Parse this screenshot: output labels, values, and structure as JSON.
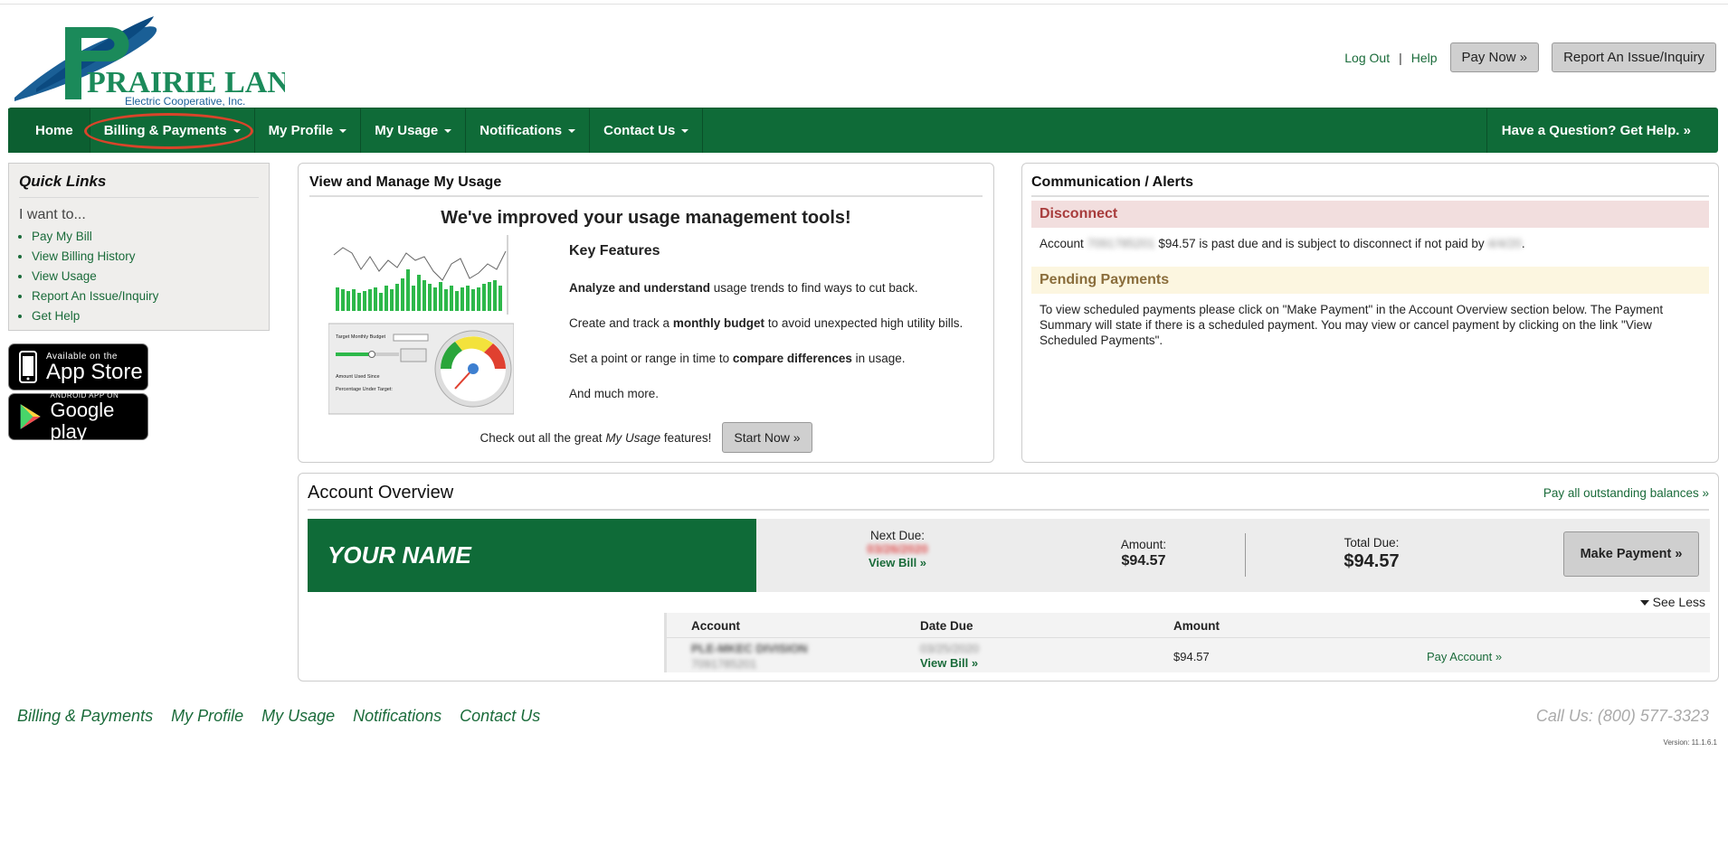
{
  "header": {
    "logo_text": "PRAIRIE LAND",
    "logo_sub": "Electric Cooperative, Inc.",
    "logout": "Log Out",
    "separator": "|",
    "help": "Help",
    "pay_now": "Pay Now »",
    "report_issue": "Report An Issue/Inquiry"
  },
  "nav": {
    "items": [
      {
        "label": "Home"
      },
      {
        "label": "Billing & Payments"
      },
      {
        "label": "My Profile"
      },
      {
        "label": "My Usage"
      },
      {
        "label": "Notifications"
      },
      {
        "label": "Contact Us"
      }
    ],
    "help_right": "Have a Question? Get Help. »"
  },
  "quick_links": {
    "title": "Quick Links",
    "intro": "I want to...",
    "items": [
      "Pay My Bill",
      "View Billing History",
      "View Usage",
      "Report An Issue/Inquiry",
      "Get Help"
    ]
  },
  "badges": {
    "apple_small": "Available on the",
    "apple_big": "App Store",
    "google_small": "ANDROID APP ON",
    "google_big": "Google play"
  },
  "usage": {
    "title": "View and Manage My Usage",
    "headline": "We've improved your usage management tools!",
    "features_title": "Key Features",
    "f1_bold": "Analyze and understand",
    "f1_rest": " usage trends to find ways to cut back.",
    "f2_pre": "Create and track a ",
    "f2_bold": "monthly budget",
    "f2_post": " to avoid unexpected high utility bills.",
    "f3_pre": "Set a point or range in time to ",
    "f3_bold": "compare differences",
    "f3_post": " in usage.",
    "f4": "And much more.",
    "cta_pre": "Check out all the great ",
    "cta_italic": "My Usage",
    "cta_post": " features!",
    "start_button": "Start Now »"
  },
  "comm": {
    "title": "Communication / Alerts",
    "disconnect_head": "Disconnect",
    "disc_pre": "Account ",
    "disc_acct": "7091785201",
    "disc_mid": " $94.57 is past due and is subject to disconnect if not paid by ",
    "disc_date": "4/4/20",
    "disc_post": ".",
    "pending_head": "Pending Payments",
    "pending_body": "To view scheduled payments please click on \"Make Payment\" in the Account Overview section below. The Payment Summary will state if there is a scheduled payment. You may view or cancel payment by clicking on the link \"View Scheduled Payments\"."
  },
  "overview": {
    "title": "Account Overview",
    "pay_all": "Pay all outstanding balances »",
    "name": "YOUR NAME",
    "next_due_label": "Next Due:",
    "next_due_date": "03/26/2020",
    "view_bill": "View Bill »",
    "amount_label": "Amount:",
    "amount_value": "$94.57",
    "total_label": "Total Due:",
    "total_value": "$94.57",
    "make_payment": "Make Payment »",
    "see_less": "See Less",
    "table": {
      "headers": [
        "Account",
        "Date Due",
        "Amount",
        ""
      ],
      "row": {
        "account_name": "PLE-MKEC DIVISION",
        "account_num": "7091785201",
        "date_due": "03/25/2020",
        "view_bill": "View Bill »",
        "amount": "$94.57",
        "pay_account": "Pay Account »"
      }
    }
  },
  "footer": {
    "links": [
      "Billing & Payments",
      "My Profile",
      "My Usage",
      "Notifications",
      "Contact Us"
    ],
    "call_us": "Call Us: (800) 577-3323",
    "version": "Version: 11.1.6.1"
  },
  "colors": {
    "brand_green": "#0f6b38",
    "link_green": "#1a6b3a",
    "alert_red": "#a83c3c",
    "highlight_ring": "#d9442a"
  }
}
